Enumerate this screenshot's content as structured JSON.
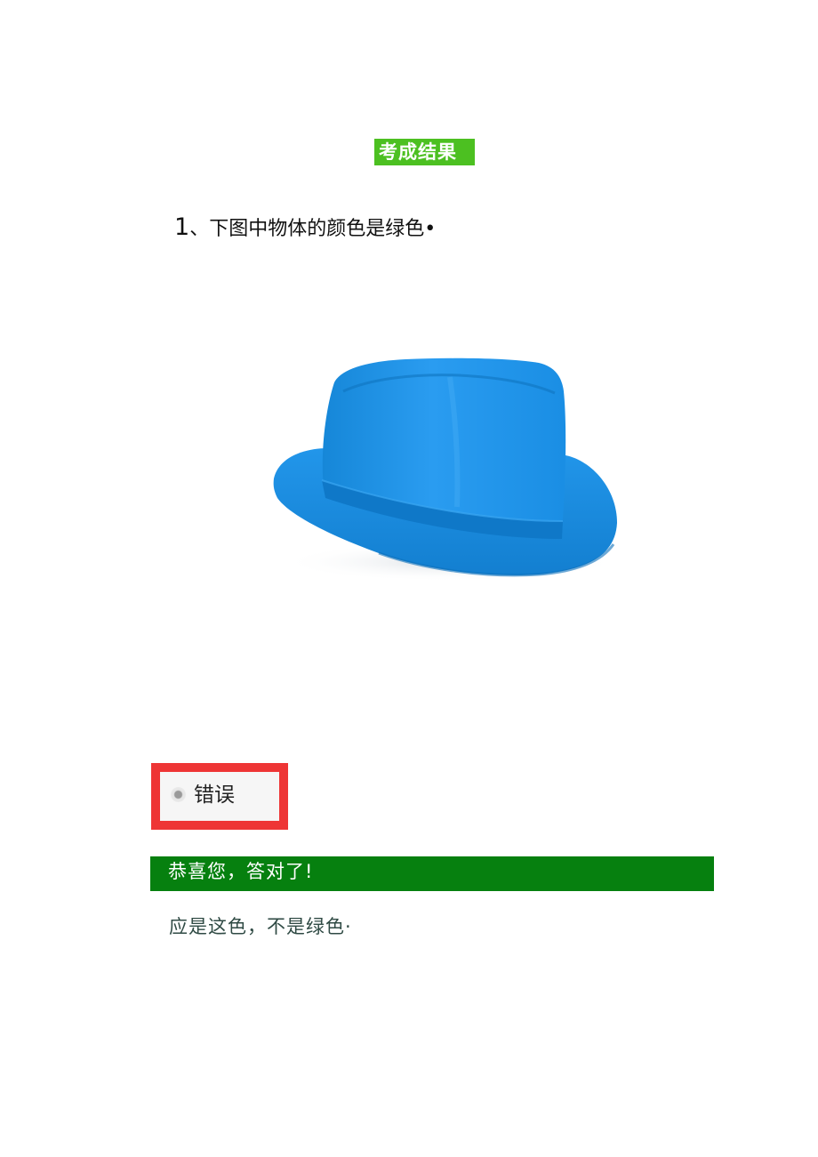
{
  "header": {
    "result_title": "考成结果"
  },
  "question": {
    "number": "1",
    "text": "、下图中物体的颜色是绿色•"
  },
  "answer": {
    "selected_label": "错误"
  },
  "feedback": {
    "message": "恭喜您，答对了!"
  },
  "explanation": {
    "text": "应是这色，不是绿色·"
  },
  "colors": {
    "title_bg": "#4cc021",
    "feedback_bg": "#06800f",
    "answer_border": "#ee3535",
    "hat_blue": "#1a8ee0"
  }
}
